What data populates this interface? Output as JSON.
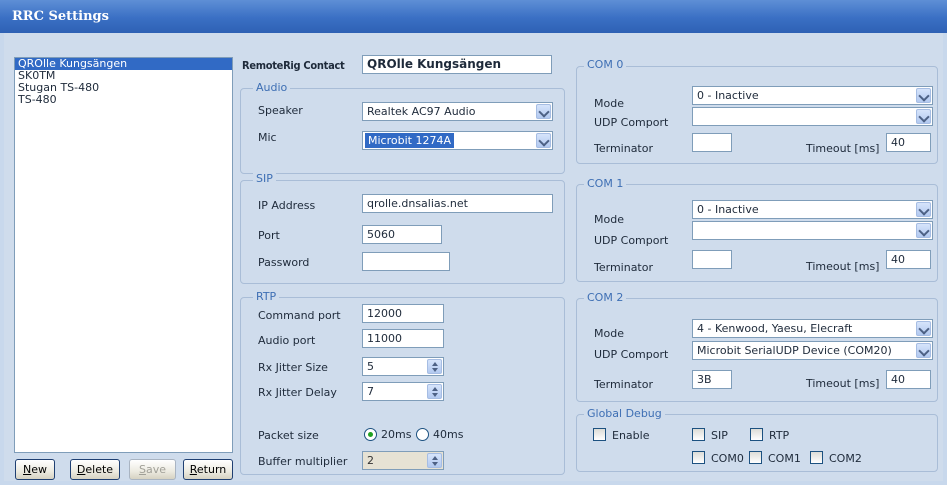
{
  "window": {
    "title": "RRC Settings"
  },
  "contacts": {
    "items": [
      "QROlle Kungsängen",
      "SK0TM",
      "Stugan TS-480",
      "TS-480"
    ],
    "selected_index": 0
  },
  "buttons": {
    "new": "New",
    "delete": "Delete",
    "save": "Save",
    "return": "Return"
  },
  "contact": {
    "label": "RemoteRig Contact",
    "value": "QROlle Kungsängen"
  },
  "audio": {
    "title": "Audio",
    "speaker_label": "Speaker",
    "speaker_value": "Realtek AC97 Audio",
    "mic_label": "Mic",
    "mic_value": "Microbit 1274A"
  },
  "sip": {
    "title": "SIP",
    "ip_label": "IP Address",
    "ip_value": "qrolle.dnsalias.net",
    "port_label": "Port",
    "port_value": "5060",
    "password_label": "Password",
    "password_value": ""
  },
  "rtp": {
    "title": "RTP",
    "command_port_label": "Command port",
    "command_port_value": "12000",
    "audio_port_label": "Audio port",
    "audio_port_value": "11000",
    "rx_jitter_size_label": "Rx Jitter Size",
    "rx_jitter_size_value": "5",
    "rx_jitter_delay_label": "Rx Jitter Delay",
    "rx_jitter_delay_value": "7",
    "packet_size_label": "Packet size",
    "packet_20": "20ms",
    "packet_40": "40ms",
    "packet_selected": "20ms",
    "buffer_multiplier_label": "Buffer multiplier",
    "buffer_multiplier_value": "2"
  },
  "com0": {
    "title": "COM 0",
    "mode_label": "Mode",
    "mode_value": "0 - Inactive",
    "udp_label": "UDP Comport",
    "udp_value": "",
    "terminator_label": "Terminator",
    "terminator_value": "",
    "timeout_label": "Timeout [ms]",
    "timeout_value": "40"
  },
  "com1": {
    "title": "COM 1",
    "mode_label": "Mode",
    "mode_value": "0 - Inactive",
    "udp_label": "UDP Comport",
    "udp_value": "",
    "terminator_label": "Terminator",
    "terminator_value": "",
    "timeout_label": "Timeout [ms]",
    "timeout_value": "40"
  },
  "com2": {
    "title": "COM 2",
    "mode_label": "Mode",
    "mode_value": "4 - Kenwood, Yaesu, Elecraft",
    "udp_label": "UDP Comport",
    "udp_value": "Microbit SerialUDP Device (COM20)",
    "terminator_label": "Terminator",
    "terminator_value": "3B",
    "timeout_label": "Timeout [ms]",
    "timeout_value": "40"
  },
  "debug": {
    "title": "Global Debug",
    "enable": "Enable",
    "sip": "SIP",
    "rtp": "RTP",
    "com0": "COM0",
    "com1": "COM1",
    "com2": "COM2"
  },
  "colors": {
    "titlebar": "#3a6fc4",
    "selection": "#316ac5",
    "group_title": "#3e6fb4",
    "panel": "#cfdcec"
  }
}
